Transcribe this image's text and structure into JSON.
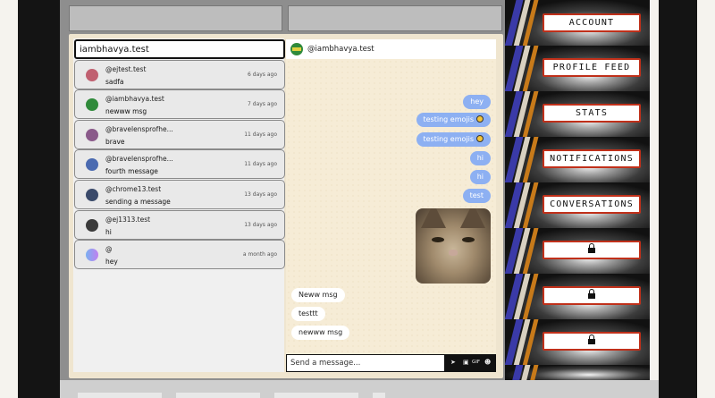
{
  "search": {
    "value": "iambhavya.test"
  },
  "conversations": [
    {
      "user": "@ejtest.test",
      "message": "sadfa",
      "time": "6 days ago",
      "avatar": "#c06070"
    },
    {
      "user": "@iambhavya.test",
      "message": "newww msg",
      "time": "7 days ago",
      "avatar": "#2f8a3a"
    },
    {
      "user": "@bravelensprofhe...",
      "message": "brave",
      "time": "11 days ago",
      "avatar": "#8a5a8a"
    },
    {
      "user": "@bravelensprofhe...",
      "message": "fourth message",
      "time": "11 days ago",
      "avatar": "#4a6ab0"
    },
    {
      "user": "@chrome13.test",
      "message": "sending a message",
      "time": "13 days ago",
      "avatar": "#3a4a6a"
    },
    {
      "user": "@ej1313.test",
      "message": "hi",
      "time": "13 days ago",
      "avatar": "#3a3a3a"
    },
    {
      "user": "@",
      "message": "hey",
      "time": "a month ago",
      "avatar": "#b080f0"
    }
  ],
  "chat": {
    "header_name": "@iambhavya.test",
    "outgoing": [
      "hey",
      "testing emojis",
      "testing emojis",
      "hi",
      "hi",
      "test"
    ],
    "incoming": [
      "Neww msg",
      "testtt",
      "newww msg"
    ],
    "compose_placeholder": "Send a message...",
    "gif_label": "GIF"
  },
  "nav": [
    "ACCOUNT",
    "PROFILE FEED",
    "STATS",
    "NOTIFICATIONS",
    "CONVERSATIONS"
  ],
  "colors": {
    "outgoing_bubble": "#8db0f2",
    "nav_border": "#c0301a"
  }
}
